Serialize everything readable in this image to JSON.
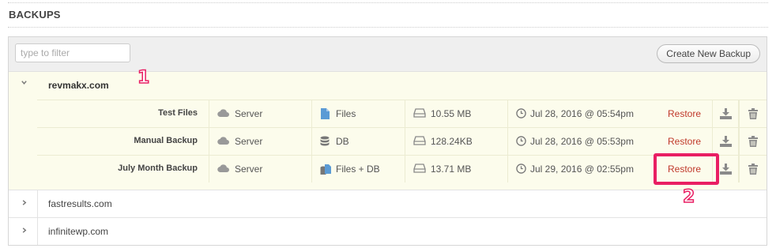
{
  "page_title": "BACKUPS",
  "toolbar": {
    "filter_placeholder": "type to filter",
    "create_label": "Create New Backup"
  },
  "sites": [
    {
      "name": "revmakx.com",
      "expanded": true,
      "backups": [
        {
          "name": "Test Files",
          "location": "Server",
          "type": "Files",
          "size": "10.55 MB",
          "date": "Jul 28, 2016 @ 05:54pm",
          "restore_label": "Restore"
        },
        {
          "name": "Manual Backup",
          "location": "Server",
          "type": "DB",
          "size": "128.24KB",
          "date": "Jul 28, 2016 @ 05:53pm",
          "restore_label": "Restore"
        },
        {
          "name": "July Month Backup",
          "location": "Server",
          "type": "Files + DB",
          "size": "13.71 MB",
          "date": "Jul 29, 2016 @ 02:55pm",
          "restore_label": "Restore"
        }
      ]
    },
    {
      "name": "fastresults.com",
      "expanded": false
    },
    {
      "name": "infinitewp.com",
      "expanded": false
    }
  ],
  "annotations": {
    "marker_1": "1",
    "marker_2": "2"
  },
  "colors": {
    "highlight_bg": "#fcfcec",
    "restore_text": "#c0392b",
    "annotation": "#e91e63"
  }
}
